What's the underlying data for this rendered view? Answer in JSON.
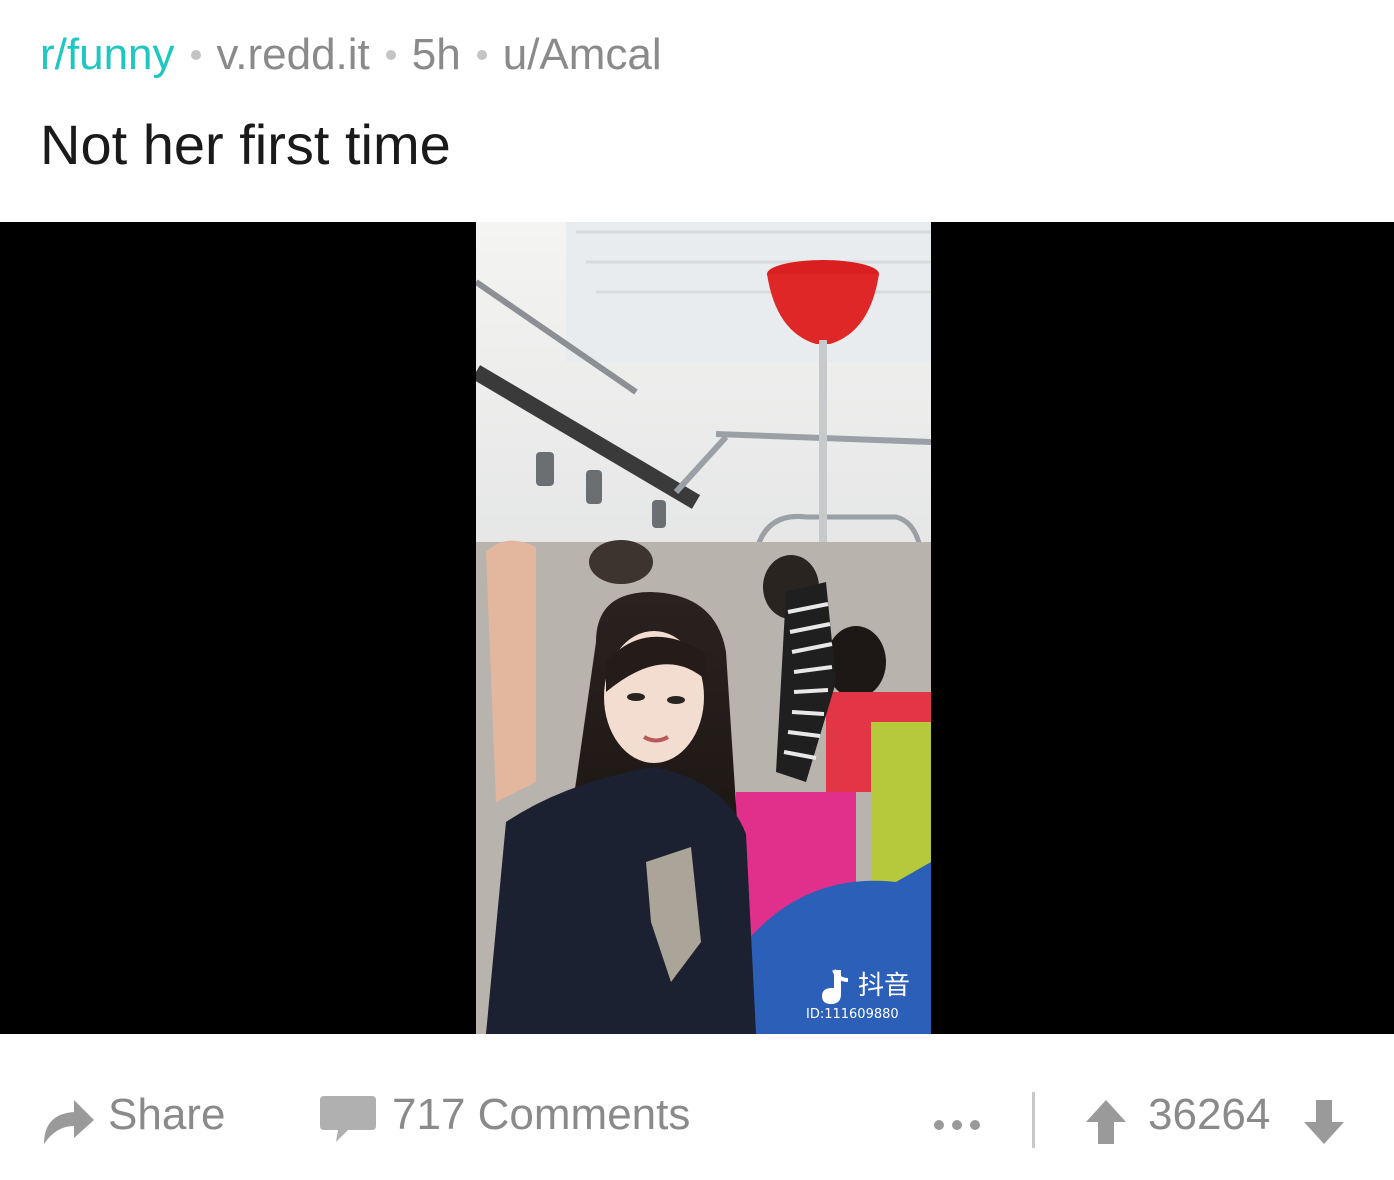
{
  "post": {
    "subreddit": "r/funny",
    "domain": "v.redd.it",
    "age": "5h",
    "author": "u/Amcal",
    "title": "Not her first time"
  },
  "video": {
    "watermark_brand": "抖音",
    "watermark_id": "ID:111609880"
  },
  "actions": {
    "share_label": "Share",
    "comments_label": "717 Comments",
    "score": "36264"
  },
  "colors": {
    "subreddit": "#1ec7c0",
    "meta_text": "#8a8a8a",
    "title_text": "#1a1a1a",
    "icon_gray": "#9a9a9a"
  },
  "icons": [
    "share-icon",
    "comment-icon",
    "more-icon",
    "upvote-icon",
    "downvote-icon",
    "tiktok-logo-icon"
  ]
}
